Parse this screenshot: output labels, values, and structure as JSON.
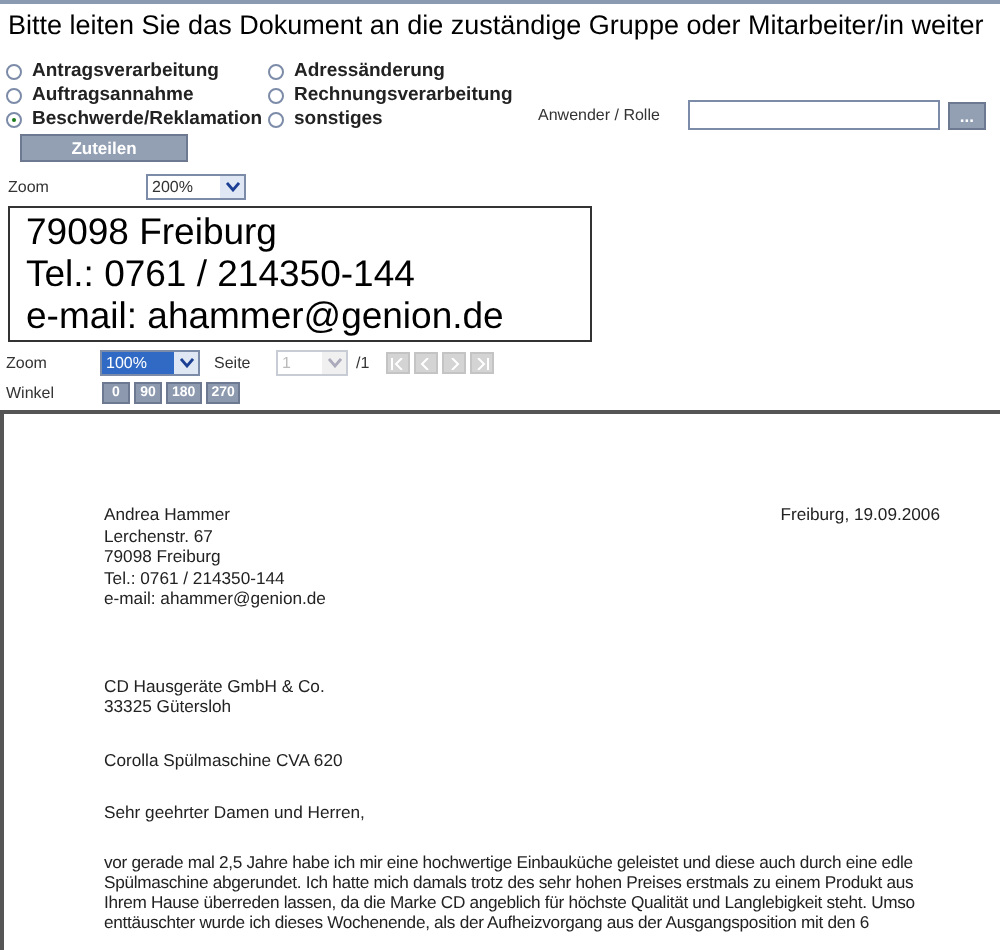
{
  "heading": "Bitte leiten Sie das Dokument an die zuständige Gruppe oder Mitarbeiter/in weiter",
  "groups": [
    {
      "label": "Antragsverarbeitung",
      "selected": false
    },
    {
      "label": "Auftragsannahme",
      "selected": false
    },
    {
      "label": "Beschwerde/Reklamation",
      "selected": true
    },
    {
      "label": "Adressänderung",
      "selected": false
    },
    {
      "label": "Rechnungsverarbeitung",
      "selected": false
    },
    {
      "label": "sonstiges",
      "selected": false
    }
  ],
  "user_role": {
    "label": "Anwender / Rolle",
    "browse_button": "..."
  },
  "assign_button": "Zuteilen",
  "detail_zoom": {
    "label": "Zoom",
    "value": "200%"
  },
  "detail_lines": [
    "79098 Freiburg",
    "Tel.: 0761 / 214350-144",
    "e-mail: ahammer@genion.de"
  ],
  "viewer": {
    "zoom_label": "Zoom",
    "zoom_value": "100%",
    "page_label": "Seite",
    "page_value": "1",
    "page_total": "/1",
    "nav_disabled": true,
    "angle_label": "Winkel",
    "angles": [
      "0",
      "90",
      "180",
      "270"
    ]
  },
  "letter": {
    "sender": [
      "Andrea Hammer",
      "Lerchenstr. 67",
      "79098 Freiburg",
      "Tel.: 0761 / 214350-144",
      "e-mail: ahammer@genion.de"
    ],
    "date": "Freiburg, 19.09.2006",
    "recipient": [
      "CD Hausgeräte GmbH & Co.",
      "33325 Gütersloh"
    ],
    "subject": "Corolla Spülmaschine CVA 620",
    "salutation": "Sehr geehrter Damen und Herren,",
    "body": [
      "vor gerade mal 2,5 Jahre habe ich mir eine hochwertige Einbauküche geleistet und diese auch durch eine edle",
      "Spülmaschine abgerundet. Ich hatte mich damals trotz des sehr hohen Preises erstmals zu einem Produkt aus",
      "Ihrem Hause überreden lassen, da die Marke CD angeblich für höchste Qualität und Langlebigkeit steht. Umso",
      "enttäuschter wurde ich dieses Wochenende, als der Aufheizvorgang aus der Ausgangsposition mit den 6"
    ]
  }
}
